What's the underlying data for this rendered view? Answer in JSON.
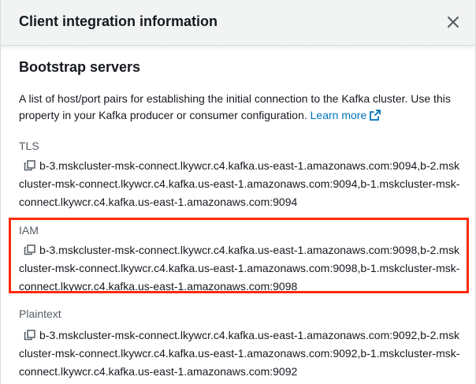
{
  "modal": {
    "title": "Client integration information",
    "close_icon": "close-icon"
  },
  "section": {
    "title": "Bootstrap servers",
    "description": "A list of host/port pairs for establishing the initial connection to the Kafka cluster. Use this property in your Kafka producer or consumer configuration.",
    "learn_more": "Learn more"
  },
  "servers": [
    {
      "label": "TLS",
      "value": "b-3.mskcluster-msk-connect.lkywcr.c4.kafka.us-east-1.amazonaws.com:9094,b-2.mskcluster-msk-connect.lkywcr.c4.kafka.us-east-1.amazonaws.com:9094,b-1.mskcluster-msk-connect.lkywcr.c4.kafka.us-east-1.amazonaws.com:9094"
    },
    {
      "label": "IAM",
      "value": "b-3.mskcluster-msk-connect.lkywcr.c4.kafka.us-east-1.amazonaws.com:9098,b-2.mskcluster-msk-connect.lkywcr.c4.kafka.us-east-1.amazonaws.com:9098,b-1.mskcluster-msk-connect.lkywcr.c4.kafka.us-east-1.amazonaws.com:9098"
    },
    {
      "label": "Plaintext",
      "value": "b-3.mskcluster-msk-connect.lkywcr.c4.kafka.us-east-1.amazonaws.com:9092,b-2.mskcluster-msk-connect.lkywcr.c4.kafka.us-east-1.amazonaws.com:9092,b-1.mskcluster-msk-connect.lkywcr.c4.kafka.us-east-1.amazonaws.com:9092"
    }
  ],
  "colors": {
    "link": "#0073bb",
    "highlight": "#ff2a0c",
    "header_bg": "#f2f3f3"
  }
}
